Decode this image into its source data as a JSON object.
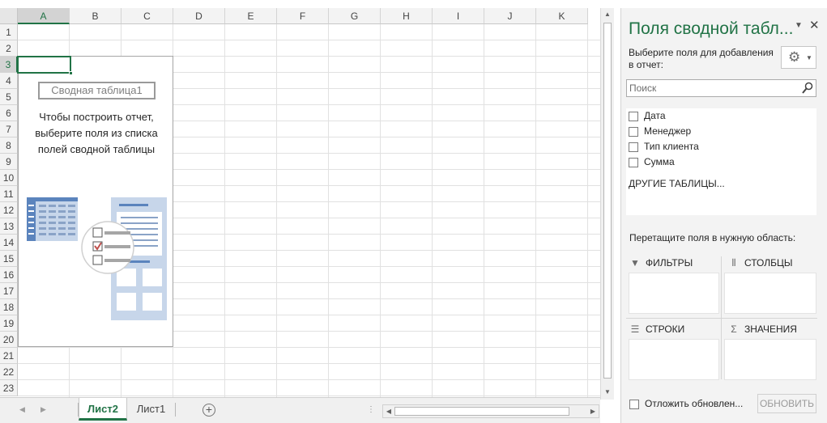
{
  "sheet": {
    "columns": [
      "A",
      "B",
      "C",
      "D",
      "E",
      "F",
      "G",
      "H",
      "I",
      "J",
      "K"
    ],
    "rows": [
      "1",
      "2",
      "3",
      "4",
      "5",
      "6",
      "7",
      "8",
      "9",
      "10",
      "11",
      "12",
      "13",
      "14",
      "15",
      "16",
      "17",
      "18",
      "19",
      "20",
      "21",
      "22",
      "23"
    ],
    "active_column": "A",
    "active_row": "3"
  },
  "pivot_placeholder": {
    "name": "Сводная таблица1",
    "help_lines": [
      "Чтобы построить отчет,",
      "выберите поля из списка",
      "полей сводной таблицы"
    ]
  },
  "tabs": {
    "items": [
      "Лист2",
      "Лист1"
    ],
    "active": "Лист2",
    "add_icon": "plus-circle-icon"
  },
  "field_pane": {
    "title": "Поля сводной табл...",
    "subtitle": "Выберите поля для добавления в отчет:",
    "search_placeholder": "Поиск",
    "fields": [
      {
        "label": "Дата",
        "checked": false
      },
      {
        "label": "Менеджер",
        "checked": false
      },
      {
        "label": "Тип клиента",
        "checked": false
      },
      {
        "label": "Сумма",
        "checked": false
      }
    ],
    "more_tables": "ДРУГИЕ ТАБЛИЦЫ...",
    "drag_hint": "Перетащите поля в нужную область:",
    "areas": {
      "filters": "ФИЛЬТРЫ",
      "columns": "СТОЛБЦЫ",
      "rows": "СТРОКИ",
      "values": "ЗНАЧЕНИЯ"
    },
    "defer_label": "Отложить обновлен...",
    "update_button": "ОБНОВИТЬ"
  },
  "colors": {
    "accent": "#217346",
    "pane_bg": "#f3f3f3",
    "illustration_blue": "#5b84bd",
    "illustration_light": "#c7d6ea",
    "check_red": "#c0504d"
  }
}
